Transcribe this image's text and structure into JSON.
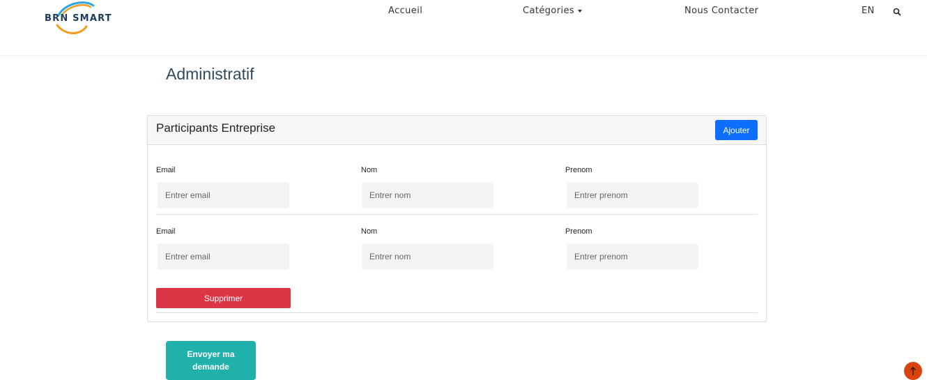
{
  "brand": {
    "name": "BRN SMART",
    "logo_icon": "brn-swoosh-logo"
  },
  "nav": {
    "accueil": "Accueil",
    "categories": "Catégories",
    "contact": "Nous Contacter",
    "lang": "EN",
    "search_icon": "search-icon"
  },
  "page": {
    "title": "Administratif"
  },
  "participants": {
    "title": "Participants Entreprise",
    "add_label": "Ajouter",
    "rows": [
      {
        "email_label": "Email",
        "email_placeholder": "Entrer email",
        "nom_label": "Nom",
        "nom_placeholder": "Entrer nom",
        "prenom_label": "Prenom",
        "prenom_placeholder": "Entrer prenom"
      },
      {
        "email_label": "Email",
        "email_placeholder": "Entrer email",
        "nom_label": "Nom",
        "nom_placeholder": "Entrer nom",
        "prenom_label": "Prenom",
        "prenom_placeholder": "Entrer prenom"
      }
    ],
    "delete_label": "Supprimer"
  },
  "actions": {
    "send_label": "Envoyer ma\ndemande"
  },
  "colors": {
    "primary": "#0d6efd",
    "danger": "#dc3545",
    "teal": "#20b2aa",
    "scroll_top": "#d9430f",
    "title": "#2f4a5c"
  },
  "scroll_top_icon": "arrow-up-icon"
}
